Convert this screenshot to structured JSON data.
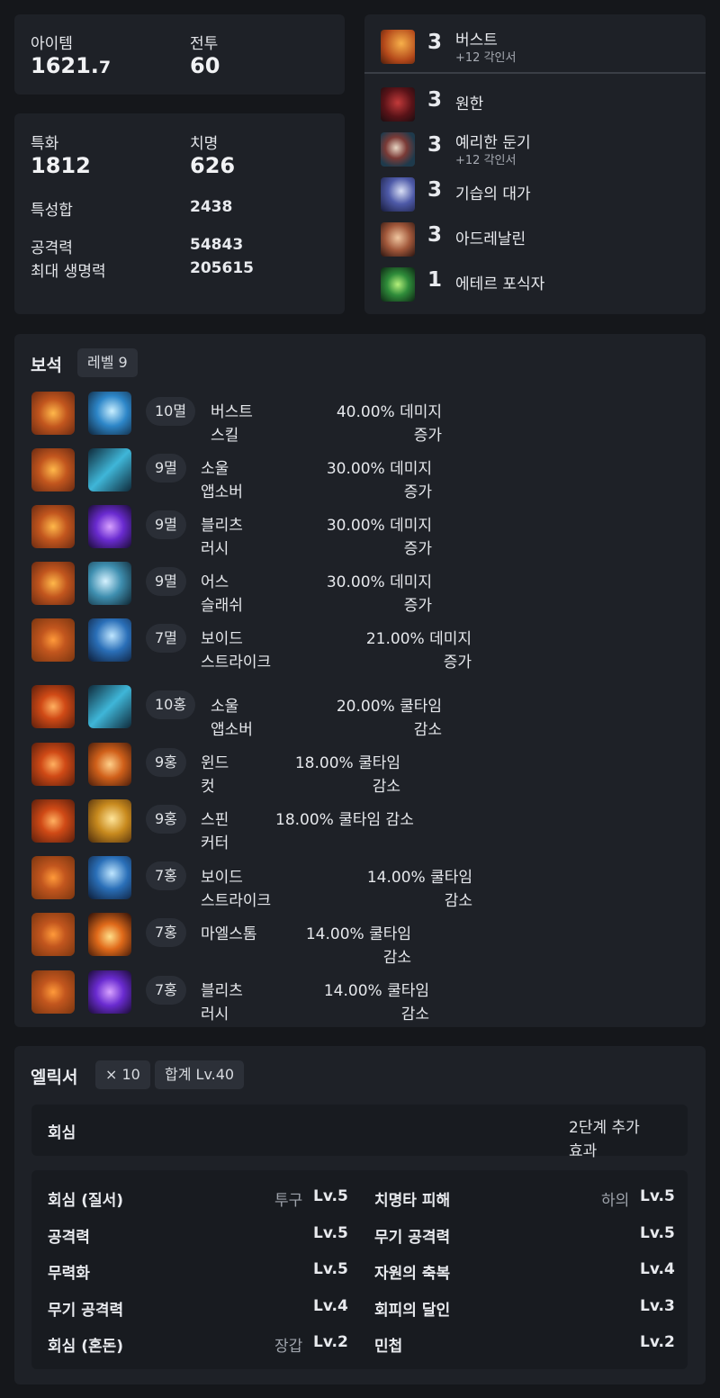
{
  "stats": {
    "item_level_label": "아이템",
    "item_level_int": "1621.",
    "item_level_dec": "7",
    "combat_label": "전투",
    "combat_value": "60",
    "spec_label": "특화",
    "spec_value": "1812",
    "crit_label": "치명",
    "crit_value": "626",
    "stat_sum_label": "특성합",
    "stat_sum_value": "2438",
    "attack_label": "공격력",
    "attack_value": "54843",
    "hp_label": "최대 생명력",
    "hp_value": "205615"
  },
  "engravings": [
    {
      "level": "3",
      "name": "버스트",
      "sub": "+12 각인서",
      "icon": "burst-icon"
    },
    {
      "level": "3",
      "name": "원한",
      "sub": "",
      "icon": "grudge-icon"
    },
    {
      "level": "3",
      "name": "예리한 둔기",
      "sub": "+12 각인서",
      "icon": "keen-blunt-weapon-icon"
    },
    {
      "level": "3",
      "name": "기습의 대가",
      "sub": "",
      "icon": "master-of-ambush-icon"
    },
    {
      "level": "3",
      "name": "아드레날린",
      "sub": "",
      "icon": "adrenaline-icon"
    },
    {
      "level": "1",
      "name": "에테르 포식자",
      "sub": "",
      "icon": "ether-predator-icon"
    }
  ],
  "gems": {
    "title": "보석",
    "level_chip": "레벨 9",
    "items": [
      {
        "level": "10멸",
        "skill_1": "버스트",
        "skill_2": "스킬",
        "effect_1": "40.00% 데미지",
        "effect_2": "증가"
      },
      {
        "level": "9멸",
        "skill_1": "소울",
        "skill_2": "앱소버",
        "effect_1": "30.00% 데미지",
        "effect_2": "증가"
      },
      {
        "level": "9멸",
        "skill_1": "블리츠",
        "skill_2": "러시",
        "effect_1": "30.00% 데미지",
        "effect_2": "증가"
      },
      {
        "level": "9멸",
        "skill_1": "어스",
        "skill_2": "슬래쉬",
        "effect_1": "30.00% 데미지",
        "effect_2": "증가"
      },
      {
        "level": "7멸",
        "skill_1": "보이드",
        "skill_2": "스트라이크",
        "effect_1": "21.00% 데미지",
        "effect_2": "증가"
      },
      {
        "level": "10홍",
        "skill_1": "소울",
        "skill_2": "앱소버",
        "effect_1": "20.00% 쿨타임",
        "effect_2": "감소"
      },
      {
        "level": "9홍",
        "skill_1": "윈드",
        "skill_2": "컷",
        "effect_1": "18.00% 쿨타임",
        "effect_2": "감소"
      },
      {
        "level": "9홍",
        "skill_1": "스핀",
        "skill_2": "커터",
        "effect_1": "18.00% 쿨타임 감소",
        "effect_2": ""
      },
      {
        "level": "7홍",
        "skill_1": "보이드",
        "skill_2": "스트라이크",
        "effect_1": "14.00% 쿨타임",
        "effect_2": "감소"
      },
      {
        "level": "7홍",
        "skill_1": "마엘스톰",
        "skill_2": "",
        "effect_1": "14.00% 쿨타임",
        "effect_2": "감소"
      },
      {
        "level": "7홍",
        "skill_1": "블리츠",
        "skill_2": "러시",
        "effect_1": "14.00% 쿨타임",
        "effect_2": "감소"
      }
    ]
  },
  "elixir": {
    "title": "엘릭서",
    "count_chip": "× 10",
    "total_chip": "합계 Lv.40",
    "set_name": "회심",
    "set_bonus_1": "2단계 추가",
    "set_bonus_2": "효과",
    "left": [
      {
        "name": "회심 (질서)",
        "slot": "투구",
        "level": "Lv.5"
      },
      {
        "name": "공격력",
        "slot": "",
        "level": "Lv.5"
      },
      {
        "name": "무력화",
        "slot": "",
        "level": "Lv.5"
      },
      {
        "name": "무기 공격력",
        "slot": "",
        "level": "Lv.4"
      },
      {
        "name": "회심 (혼돈)",
        "slot": "장갑",
        "level": "Lv.2"
      }
    ],
    "right": [
      {
        "name": "치명타 피해",
        "slot": "하의",
        "level": "Lv.5"
      },
      {
        "name": "무기 공격력",
        "slot": "",
        "level": "Lv.5"
      },
      {
        "name": "자원의 축복",
        "slot": "",
        "level": "Lv.4"
      },
      {
        "name": "회피의 달인",
        "slot": "",
        "level": "Lv.3"
      },
      {
        "name": "민첩",
        "slot": "",
        "level": "Lv.2"
      }
    ]
  },
  "colors": {
    "background": "#15171b",
    "card": "#1e2127",
    "text": "#e8eaee",
    "muted": "#9ea3ab"
  }
}
